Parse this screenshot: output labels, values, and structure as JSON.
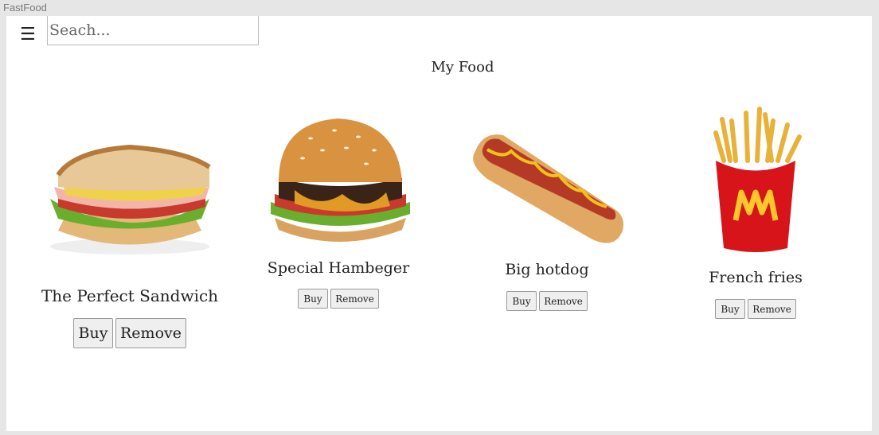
{
  "window": {
    "title": "FastFood"
  },
  "header": {
    "menu_icon": "hamburger-menu-icon",
    "search_placeholder": "Seach..."
  },
  "main": {
    "title": "My Food",
    "items": [
      {
        "name": "The Perfect Sandwich",
        "image": "sandwich-image",
        "buy_label": "Buy",
        "remove_label": "Remove"
      },
      {
        "name": "Special Hambeger",
        "image": "hamburger-image",
        "buy_label": "Buy",
        "remove_label": "Remove"
      },
      {
        "name": "Big hotdog",
        "image": "hotdog-image",
        "buy_label": "Buy",
        "remove_label": "Remove"
      },
      {
        "name": "French fries",
        "image": "french-fries-image",
        "buy_label": "Buy",
        "remove_label": "Remove"
      }
    ]
  },
  "colors": {
    "page_background": "#e6e6e6",
    "content_background": "#ffffff",
    "fries_box_red": "#d7141a",
    "arches_yellow": "#ffc72c"
  }
}
